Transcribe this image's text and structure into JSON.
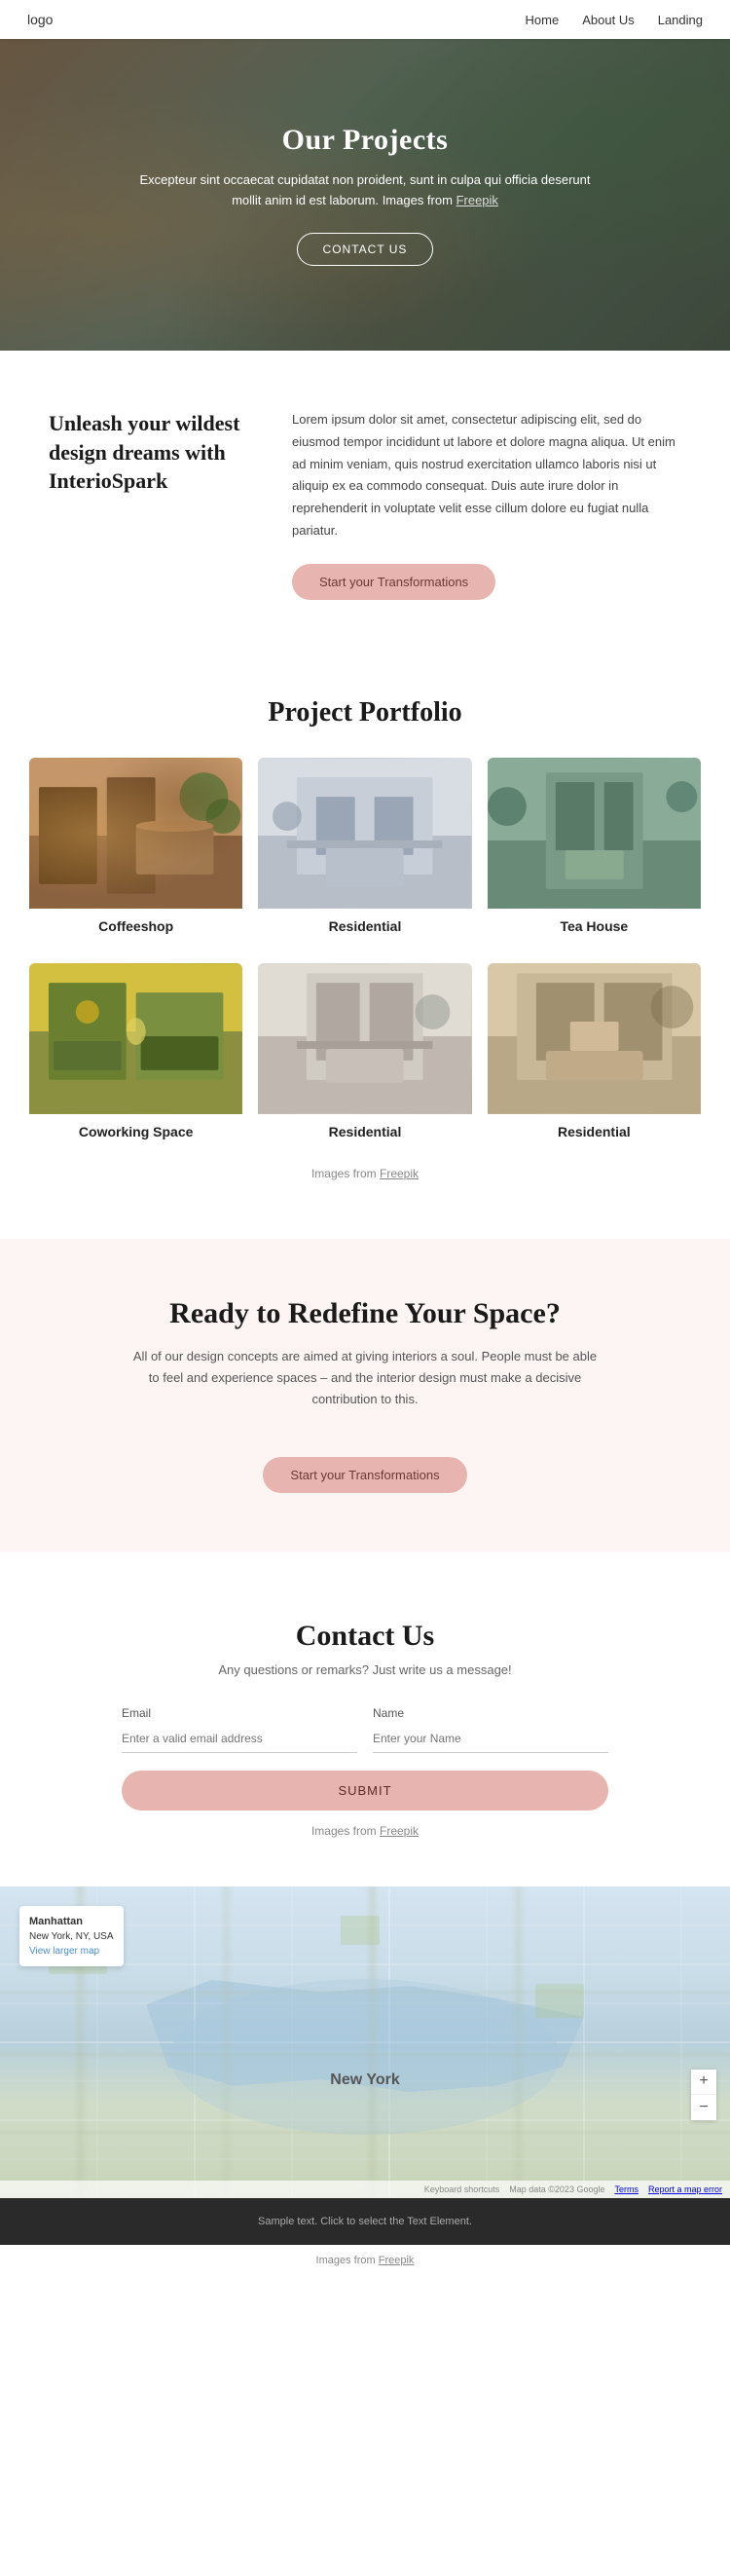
{
  "nav": {
    "logo": "logo",
    "links": [
      {
        "label": "Home",
        "href": "#"
      },
      {
        "label": "About Us",
        "href": "#"
      },
      {
        "label": "Landing",
        "href": "#"
      }
    ]
  },
  "hero": {
    "title": "Our Projects",
    "description": "Excepteur sint occaecat cupidatat non proident, sunt in culpa qui officia deserunt mollit anim id est laborum. Images from",
    "freepik_link": "Freepik",
    "cta_label": "CONTACT US"
  },
  "intro": {
    "heading": "Unleash your wildest design dreams with InterioSpark",
    "body": "Lorem ipsum dolor sit amet, consectetur adipiscing elit, sed do eiusmod tempor incididunt ut labore et dolore magna aliqua. Ut enim ad minim veniam, quis nostrud exercitation ullamco laboris nisi ut aliquip ex ea commodo consequat. Duis aute irure dolor in reprehenderit in voluptate velit esse cillum dolore eu fugiat nulla pariatur.",
    "cta_label": "Start your Transformations"
  },
  "portfolio": {
    "title": "Project Portfolio",
    "items": [
      {
        "label": "Coffeeshop",
        "img_class": "img-coffeeshop"
      },
      {
        "label": "Residential",
        "img_class": "img-residential-1"
      },
      {
        "label": "Tea House",
        "img_class": "img-teahouse"
      },
      {
        "label": "Coworking Space",
        "img_class": "img-coworking"
      },
      {
        "label": "Residential",
        "img_class": "img-residential-2"
      },
      {
        "label": "Residential",
        "img_class": "img-residential-3"
      }
    ],
    "footer_text": "Images from",
    "footer_link": "Freepik"
  },
  "cta": {
    "title": "Ready to Redefine Your Space?",
    "description": "All of our design concepts are aimed at giving interiors a soul. People must be able to feel and experience spaces – and the interior design must make a decisive contribution to this.",
    "cta_label": "Start your Transformations"
  },
  "contact": {
    "title": "Contact Us",
    "subtitle": "Any questions or remarks? Just write us a message!",
    "email_label": "Email",
    "email_placeholder": "Enter a valid email address",
    "name_label": "Name",
    "name_placeholder": "Enter your Name",
    "submit_label": "SUBMIT",
    "footer_text": "Images from",
    "footer_link": "Freepik"
  },
  "map": {
    "pin_title": "Manhattan",
    "pin_address": "New York, NY, USA",
    "pin_link": "View larger map",
    "city_label": "New York",
    "zoom_in": "+",
    "zoom_out": "−",
    "footer_items": [
      "Keyboard shortcuts",
      "Map data ©2023 Google",
      "Terms",
      "Report a map error"
    ]
  },
  "footer": {
    "sample_text": "Sample text. Click to select the Text Element.",
    "images_text": "Images from",
    "images_link": "Freepik"
  }
}
